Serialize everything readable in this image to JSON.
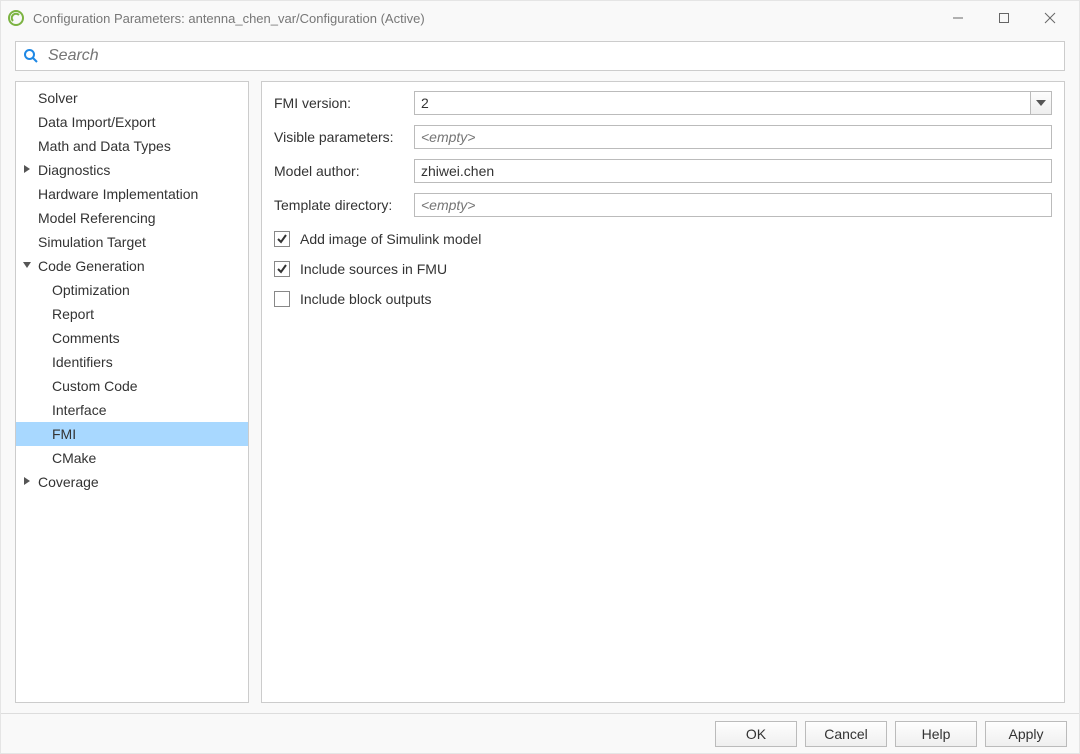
{
  "window": {
    "title": "Configuration Parameters: antenna_chen_var/Configuration (Active)"
  },
  "search": {
    "placeholder": "Search"
  },
  "sidebar": {
    "items": [
      {
        "label": "Solver",
        "level": 0,
        "expandable": false,
        "expanded": false
      },
      {
        "label": "Data Import/Export",
        "level": 0,
        "expandable": false,
        "expanded": false
      },
      {
        "label": "Math and Data Types",
        "level": 0,
        "expandable": false,
        "expanded": false
      },
      {
        "label": "Diagnostics",
        "level": 0,
        "expandable": true,
        "expanded": false
      },
      {
        "label": "Hardware Implementation",
        "level": 0,
        "expandable": false,
        "expanded": false
      },
      {
        "label": "Model Referencing",
        "level": 0,
        "expandable": false,
        "expanded": false
      },
      {
        "label": "Simulation Target",
        "level": 0,
        "expandable": false,
        "expanded": false
      },
      {
        "label": "Code Generation",
        "level": 0,
        "expandable": true,
        "expanded": true
      },
      {
        "label": "Optimization",
        "level": 1,
        "expandable": false,
        "expanded": false
      },
      {
        "label": "Report",
        "level": 1,
        "expandable": false,
        "expanded": false
      },
      {
        "label": "Comments",
        "level": 1,
        "expandable": false,
        "expanded": false
      },
      {
        "label": "Identifiers",
        "level": 1,
        "expandable": false,
        "expanded": false
      },
      {
        "label": "Custom Code",
        "level": 1,
        "expandable": false,
        "expanded": false
      },
      {
        "label": "Interface",
        "level": 1,
        "expandable": false,
        "expanded": false
      },
      {
        "label": "FMI",
        "level": 1,
        "expandable": false,
        "expanded": false,
        "selected": true
      },
      {
        "label": "CMake",
        "level": 1,
        "expandable": false,
        "expanded": false
      },
      {
        "label": "Coverage",
        "level": 0,
        "expandable": true,
        "expanded": false
      }
    ]
  },
  "form": {
    "fmi_version": {
      "label": "FMI version:",
      "value": "2"
    },
    "visible_params": {
      "label": "Visible parameters:",
      "placeholder": "<empty>",
      "value": ""
    },
    "model_author": {
      "label": "Model author:",
      "value": "zhiwei.chen"
    },
    "template_dir": {
      "label": "Template directory:",
      "placeholder": "<empty>",
      "value": ""
    },
    "add_image": {
      "label": "Add image of Simulink model",
      "checked": true
    },
    "include_sources": {
      "label": "Include sources in FMU",
      "checked": true
    },
    "include_block_out": {
      "label": "Include block outputs",
      "checked": false
    }
  },
  "footer": {
    "ok": "OK",
    "cancel": "Cancel",
    "help": "Help",
    "apply": "Apply"
  }
}
